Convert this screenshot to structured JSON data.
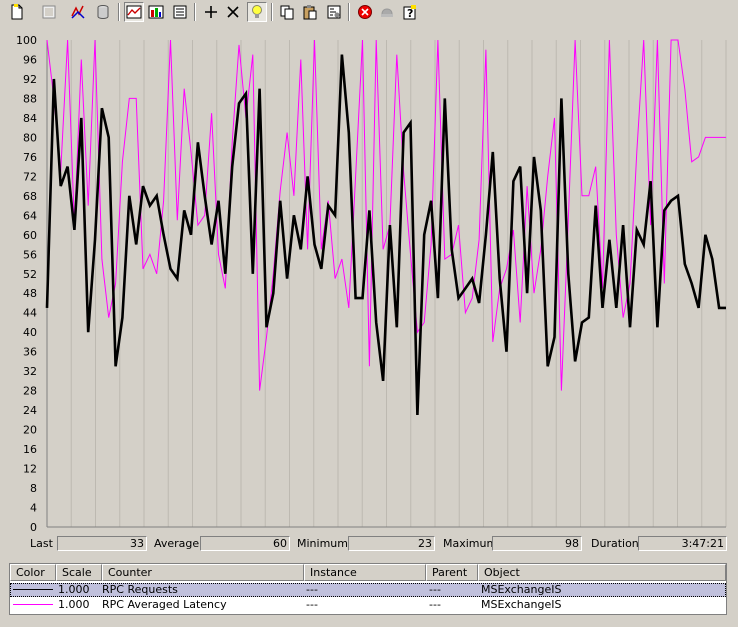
{
  "toolbar": {
    "buttons": [
      {
        "name": "new-counter-set-icon"
      },
      {
        "name": "clear-display-icon"
      },
      {
        "name": "view-current-activity-icon"
      },
      {
        "name": "view-log-data-icon"
      },
      {
        "name": "view-graph-icon",
        "pressed": true
      },
      {
        "name": "view-histogram-icon"
      },
      {
        "name": "view-report-icon"
      },
      {
        "name": "add-counter-icon"
      },
      {
        "name": "delete-counter-icon"
      },
      {
        "name": "highlight-icon",
        "pressed": true
      },
      {
        "name": "copy-properties-icon"
      },
      {
        "name": "paste-counter-list-icon"
      },
      {
        "name": "properties-icon"
      },
      {
        "name": "freeze-display-icon"
      },
      {
        "name": "update-data-icon"
      },
      {
        "name": "help-icon"
      }
    ]
  },
  "colors": {
    "background": "#d4d0c8",
    "plot_background": "#d4d0c8",
    "rpc_requests": "#000000",
    "rpc_latency": "#ff00ff"
  },
  "chart_data": {
    "type": "line",
    "ylim": [
      0,
      100
    ],
    "yticks": [
      "100",
      "96",
      "92",
      "88",
      "84",
      "80",
      "76",
      "72",
      "68",
      "64",
      "60",
      "56",
      "52",
      "48",
      "44",
      "40",
      "36",
      "32",
      "28",
      "24",
      "20",
      "16",
      "12",
      "8",
      "4",
      "0"
    ],
    "grid": "vertical",
    "x": [
      0,
      1,
      2,
      3,
      4,
      5,
      6,
      7,
      8,
      9,
      10,
      11,
      12,
      13,
      14,
      15,
      16,
      17,
      18,
      19,
      20,
      21,
      22,
      23,
      24,
      25,
      26,
      27,
      28,
      29,
      30,
      31,
      32,
      33,
      34,
      35,
      36,
      37,
      38,
      39,
      40,
      41,
      42,
      43,
      44,
      45,
      46,
      47,
      48,
      49,
      50,
      51,
      52,
      53,
      54,
      55,
      56,
      57,
      58,
      59,
      60,
      61,
      62,
      63,
      64,
      65,
      66,
      67,
      68,
      69,
      70,
      71,
      72,
      73,
      74,
      75,
      76,
      77,
      78,
      79,
      80,
      81,
      82,
      83,
      84,
      85,
      86,
      87,
      88,
      89,
      90,
      91,
      92,
      93,
      94,
      95,
      96,
      97,
      98,
      99
    ],
    "series": [
      {
        "name": "RPC Requests",
        "color": "#000000",
        "values": [
          45,
          92,
          70,
          74,
          61,
          84,
          40,
          59,
          86,
          80,
          33,
          43,
          68,
          58,
          70,
          66,
          68,
          60,
          53,
          51,
          65,
          60,
          79,
          68,
          58,
          67,
          52,
          74,
          87,
          89,
          52,
          90,
          41,
          48,
          67,
          51,
          64,
          57,
          72,
          58,
          53,
          66,
          64,
          97,
          81,
          47,
          47,
          65,
          42,
          30,
          62,
          41,
          81,
          83,
          23,
          60,
          67,
          47,
          88,
          57,
          47,
          49,
          51,
          46,
          60,
          77,
          51,
          36,
          71,
          74,
          48,
          76,
          65,
          33,
          39,
          88,
          52,
          34,
          42,
          43,
          66,
          45,
          59,
          45,
          62,
          41,
          61,
          58,
          71,
          41,
          65,
          67,
          68,
          54,
          50,
          45,
          60,
          55,
          45,
          45
        ],
        "width": 2.6
      },
      {
        "name": "RPC Averaged Latency",
        "color": "#ff00ff",
        "values": [
          100,
          88,
          73,
          100,
          62,
          96,
          66,
          100,
          55,
          43,
          50,
          75,
          88,
          88,
          53,
          56,
          52,
          67,
          100,
          63,
          90,
          77,
          62,
          64,
          85,
          56,
          49,
          79,
          99,
          84,
          97,
          28,
          39,
          52,
          69,
          81,
          68,
          96,
          57,
          100,
          57,
          67,
          51,
          55,
          45,
          72,
          100,
          33,
          100,
          57,
          62,
          97,
          73,
          56,
          40,
          42,
          58,
          100,
          55,
          56,
          62,
          44,
          47,
          59,
          98,
          38,
          49,
          53,
          61,
          42,
          70,
          48,
          57,
          72,
          84,
          28,
          63,
          100,
          68,
          68,
          74,
          49,
          100,
          60,
          43,
          50,
          77,
          100,
          62,
          100,
          50,
          100,
          100,
          90,
          75,
          76,
          80,
          80,
          80,
          80
        ],
        "width": 1
      }
    ]
  },
  "stats": {
    "last_label": "Last",
    "last_value": "33",
    "average_label": "Average",
    "average_value": "60",
    "minimum_label": "Minimum",
    "minimum_value": "23",
    "maximum_label": "Maximum",
    "maximum_value": "98",
    "duration_label": "Duration",
    "duration_value": "3:47:21"
  },
  "legend": {
    "headers": {
      "color": "Color",
      "scale": "Scale",
      "counter": "Counter",
      "instance": "Instance",
      "parent": "Parent",
      "object": "Object"
    },
    "rows": [
      {
        "color": "#000000",
        "scale": "1.000",
        "counter": "RPC Requests",
        "instance": "---",
        "parent": "---",
        "object": "MSExchangeIS",
        "selected": true
      },
      {
        "color": "#ff00ff",
        "scale": "1.000",
        "counter": "RPC Averaged Latency",
        "instance": "---",
        "parent": "---",
        "object": "MSExchangeIS",
        "selected": false
      }
    ]
  }
}
